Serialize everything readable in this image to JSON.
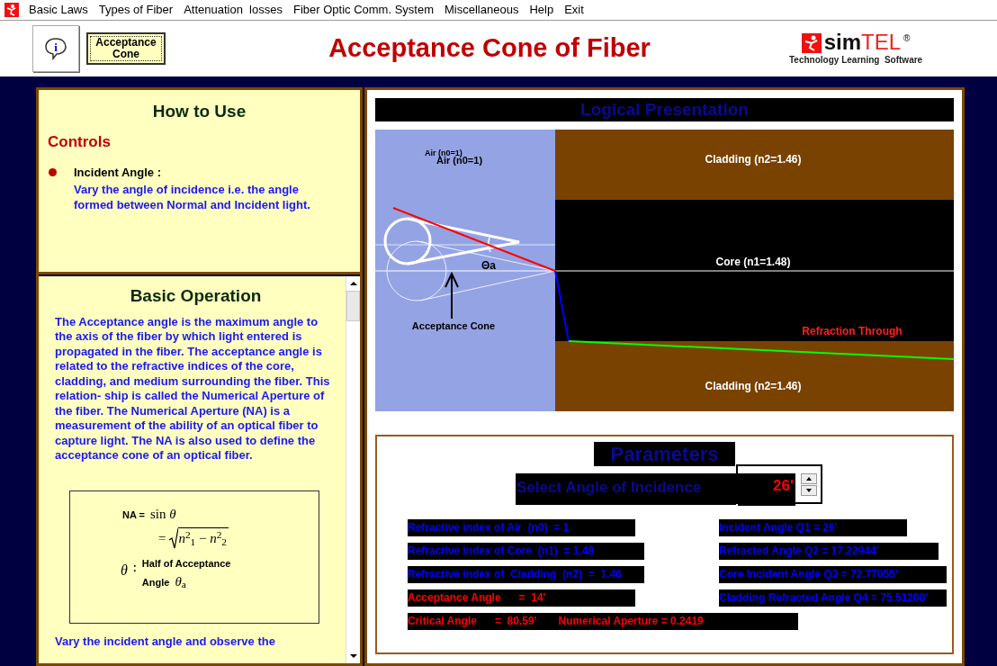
{
  "menu": [
    "Basic Laws",
    "Types of Fiber",
    "Attenuation  losses",
    "Fiber Optic Comm. System",
    "Miscellaneous",
    "Help",
    "Exit"
  ],
  "header": {
    "info_glyph": "i",
    "mode_button": "Acceptance Cone",
    "title": "Acceptance Cone of Fiber",
    "logo": {
      "bold": "sim",
      "light": "TEL",
      "mark": "®",
      "tagline": "Technology Learning  Software"
    }
  },
  "how_to_use": {
    "title": "How to Use",
    "section": "Controls",
    "items": [
      {
        "term": "Incident Angle :",
        "text": "Vary the angle of incidence i.e. the angle formed between Normal and Incident light."
      }
    ]
  },
  "basic_operation": {
    "title": "Basic Operation",
    "paragraph": "The Acceptance angle is the maximum angle to the axis of the fiber by which light entered is propagated in the fiber. The acceptance angle is related to the refractive indices of the core, cladding, and medium surrounding the fiber. This relation- ship is called the Numerical Aperture of the fiber. The Numerical Aperture (NA) is a measurement of the ability of an optical fiber to capture light. The NA is also used to define the acceptance cone of an optical fiber.",
    "formula": {
      "lhs": "NA =",
      "rhs": "sin *θ*",
      "eq": "=",
      "radicand": "*n*$^{2}$$_{1}$ − *n*$^{2}$$_{2}$",
      "symbol": "*θ*",
      "colon": ":",
      "note": "Half of Acceptance",
      "note2": "Angle",
      "note_symbol": "*θ*$_{a}$"
    },
    "footer_text": "Vary the incident angle and observe the"
  },
  "logical": {
    "title": "Logical Presentation",
    "diagram": {
      "air_labels": [
        "Air (n0=1)",
        "Air (n0=1)"
      ],
      "cladding_top": "Cladding (n2=1.46)",
      "core": "Core (n1=1.48)",
      "refraction": "Refraction Through",
      "cladding_bottom": "Cladding (n2=1.46)",
      "angle_label": "Θa",
      "cone_label": "Acceptance Cone"
    }
  },
  "parameters": {
    "title": "Parameters",
    "select_label": "Select Angle of Incidence",
    "select_value": "26'",
    "left": [
      {
        "text": "Refractive index of Air  (n0)  = 1",
        "kind": "input"
      },
      {
        "text": "Refractive index of Core  (n1)  = 1.48",
        "kind": "input"
      },
      {
        "text": "Refractive index of  Cladding  (n2)  =  1.46",
        "kind": "input"
      },
      {
        "text": "Acceptance Angle      =  14'",
        "kind": "result"
      }
    ],
    "right": [
      {
        "text": "Incident Angle Q1 = 26'",
        "kind": "input"
      },
      {
        "text": "Refracted Angle Q2 = 17.22944'",
        "kind": "input"
      },
      {
        "text": "Core Incident Angle Q3 = 72.77055'",
        "kind": "input"
      },
      {
        "text": "Cladding Refracted Angle Q4 = 75.51208'",
        "kind": "input"
      }
    ],
    "bottom": [
      {
        "text": "Critical Angle      =  80.59'",
        "kind": "result"
      },
      {
        "text": "Numerical Aperture = 0.2419",
        "kind": "result"
      }
    ]
  }
}
